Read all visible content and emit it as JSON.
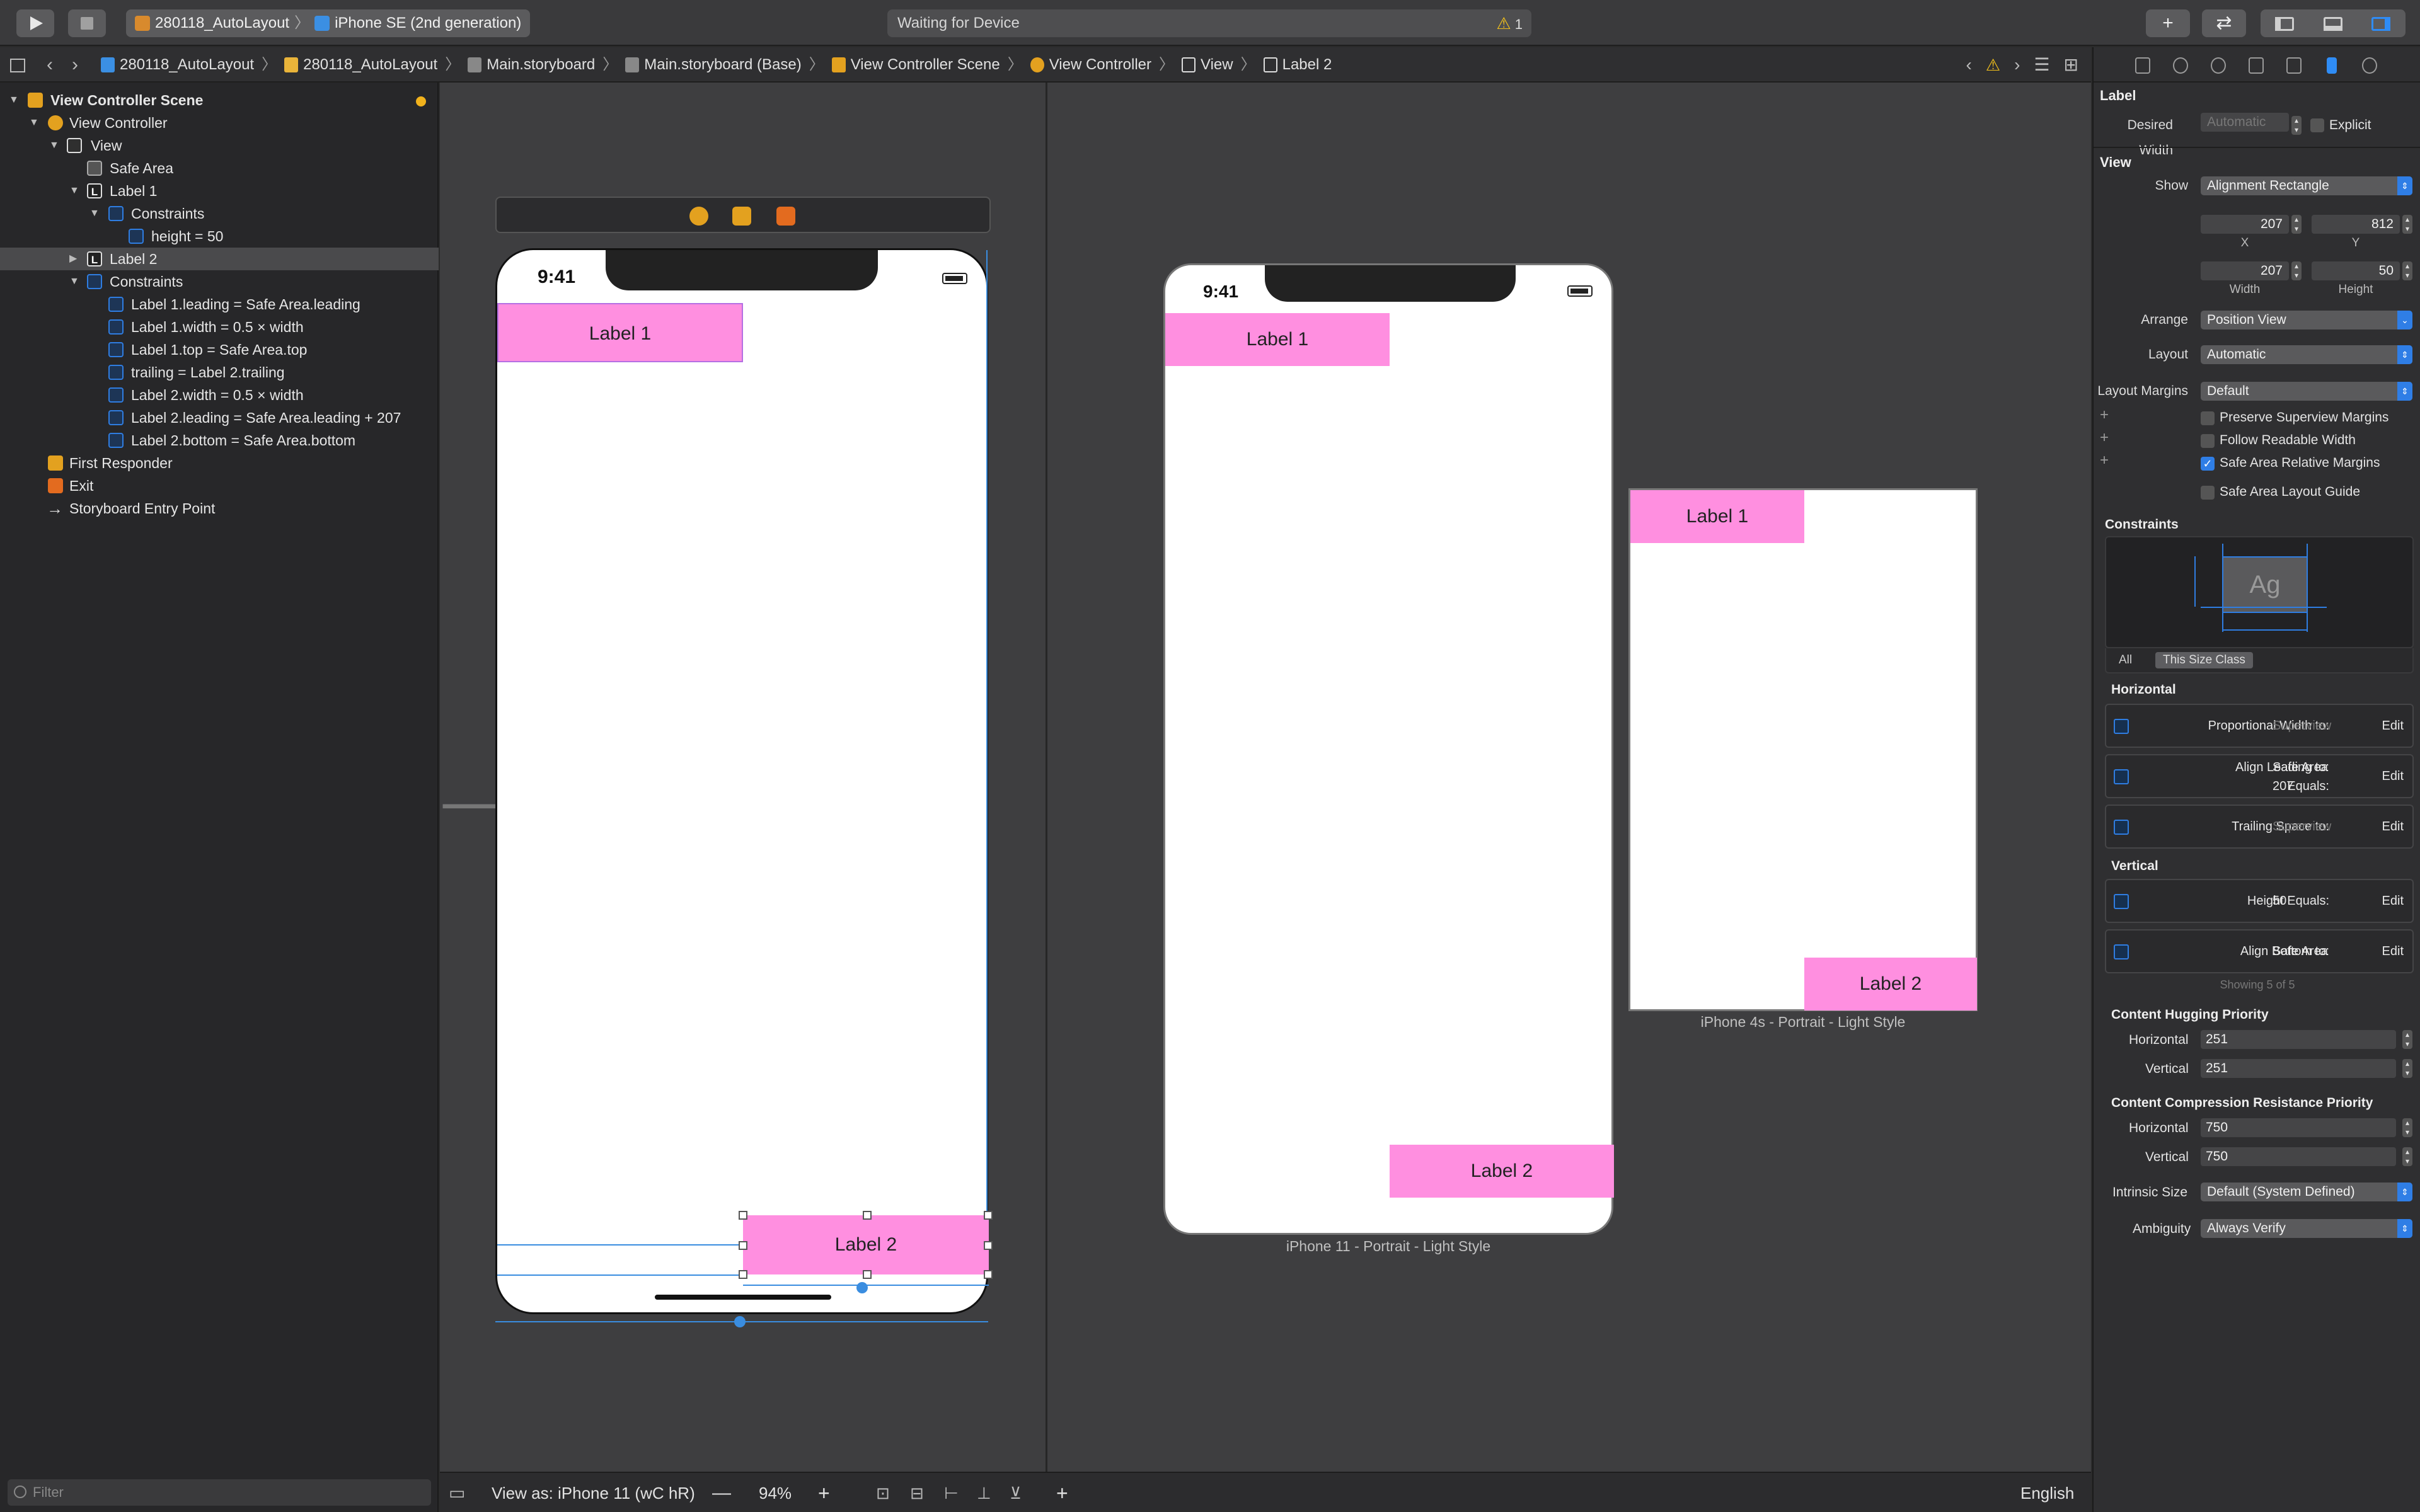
{
  "toolbar": {
    "scheme_project": "280118_AutoLayout",
    "scheme_device": "iPhone SE (2nd generation)",
    "activity_text": "Waiting for Device",
    "warning_count": "1"
  },
  "jumpbar": {
    "crumbs": [
      "280118_AutoLayout",
      "280118_AutoLayout",
      "Main.storyboard",
      "Main.storyboard (Base)",
      "View Controller Scene",
      "View Controller",
      "View",
      "Label 2"
    ]
  },
  "outline": {
    "rows": [
      {
        "label": "View Controller Scene"
      },
      {
        "label": "View Controller"
      },
      {
        "label": "View"
      },
      {
        "label": "Safe Area"
      },
      {
        "label": "Label 1"
      },
      {
        "label": "Constraints"
      },
      {
        "label": "height = 50"
      },
      {
        "label": "Label 2"
      },
      {
        "label": "Constraints"
      },
      {
        "label": "Label 1.leading = Safe Area.leading"
      },
      {
        "label": "Label 1.width = 0.5 × width"
      },
      {
        "label": "Label 1.top = Safe Area.top"
      },
      {
        "label": "trailing = Label 2.trailing"
      },
      {
        "label": "Label 2.width = 0.5 × width"
      },
      {
        "label": "Label 2.leading = Safe Area.leading + 207"
      },
      {
        "label": "Label 2.bottom = Safe Area.bottom"
      },
      {
        "label": "First Responder"
      },
      {
        "label": "Exit"
      },
      {
        "label": "Storyboard Entry Point"
      }
    ],
    "filter_placeholder": "Filter"
  },
  "canvas": {
    "main_device": {
      "time": "9:41",
      "label1": "Label 1",
      "label2": "Label 2"
    },
    "preview_iphone11": {
      "time": "9:41",
      "label1": "Label 1",
      "label2": "Label 2",
      "caption": "iPhone 11 - Portrait - Light Style"
    },
    "preview_iphone4s": {
      "label1": "Label 1",
      "label2": "Label 2",
      "caption": "iPhone 4s - Portrait - Light Style"
    }
  },
  "bottombar": {
    "view_as": "View as: iPhone 11 (wC hR)",
    "zoom": "94%",
    "language": "English"
  },
  "inspector": {
    "label_section": "Label",
    "desired_width_key": "Desired Width",
    "desired_width_value": "Automatic",
    "explicit_label": "Explicit",
    "view_section": "View",
    "show_key": "Show",
    "show_value": "Alignment Rectangle",
    "x_value": "207",
    "y_value": "812",
    "x_key": "X",
    "y_key": "Y",
    "width_value": "207",
    "height_value": "50",
    "width_key": "Width",
    "height_key": "Height",
    "arrange_key": "Arrange",
    "arrange_value": "Position View",
    "layout_key": "Layout",
    "layout_value": "Automatic",
    "layout_margins_key": "Layout Margins",
    "layout_margins_value": "Default",
    "preserve_superview_margins": "Preserve Superview Margins",
    "follow_readable_width": "Follow Readable Width",
    "safe_area_relative_margins": "Safe Area Relative Margins",
    "safe_area_layout_guide": "Safe Area Layout Guide",
    "constraints_section": "Constraints",
    "ag_text": "Ag",
    "filter_all": "All",
    "filter_this_size_class": "This Size Class",
    "horizontal_section": "Horizontal",
    "vertical_section": "Vertical",
    "constraints": [
      {
        "title": "Proportional Width to:",
        "value": "Superview",
        "dim": true,
        "edit": "Edit"
      },
      {
        "title": "Align Leading to:",
        "value": "Safe Area",
        "title2": "Equals:",
        "value2": "207",
        "edit": "Edit"
      },
      {
        "title": "Trailing Space to:",
        "value": "Superview",
        "dim": true,
        "edit": "Edit"
      },
      {
        "title": "Height Equals:",
        "value": "50",
        "edit": "Edit"
      },
      {
        "title": "Align Bottom to:",
        "value": "Safe Area",
        "edit": "Edit"
      }
    ],
    "showing_text": "Showing 5 of 5",
    "hugging_section": "Content Hugging Priority",
    "compression_section": "Content Compression Resistance Priority",
    "horizontal_key": "Horizontal",
    "vertical_key": "Vertical",
    "hug_h": "251",
    "hug_v": "251",
    "comp_h": "750",
    "comp_v": "750",
    "intrinsic_key": "Intrinsic Size",
    "intrinsic_value": "Default (System Defined)",
    "ambiguity_key": "Ambiguity",
    "ambiguity_value": "Always Verify"
  }
}
